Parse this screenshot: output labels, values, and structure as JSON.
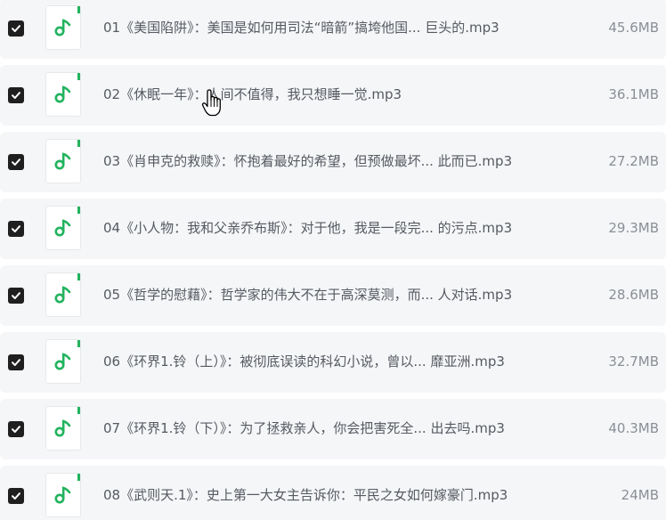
{
  "files": [
    {
      "name": "01《美国陷阱》：美国是如何用司法“暗箭”搞垮他国...  巨头的.mp3",
      "size": "45.6MB",
      "checked": true,
      "icon": "music-file-icon"
    },
    {
      "name": "02《休眠一年》：人间不值得，我只想睡一觉.mp3",
      "size": "36.1MB",
      "checked": true,
      "icon": "music-file-icon"
    },
    {
      "name": "03《肖申克的救赎》：怀抱着最好的希望，但预做最坏...  此而已.mp3",
      "size": "27.2MB",
      "checked": true,
      "icon": "music-file-icon"
    },
    {
      "name": "04《小人物：我和父亲乔布斯》：对于他，我是一段完...  的污点.mp3",
      "size": "29.3MB",
      "checked": true,
      "icon": "music-file-icon"
    },
    {
      "name": "05《哲学的慰藉》：哲学家的伟大不在于高深莫测，而...  人对话.mp3",
      "size": "28.6MB",
      "checked": true,
      "icon": "music-file-icon"
    },
    {
      "name": "06《环界1.铃（上）》：被彻底误读的科幻小说，曾以...  靡亚洲.mp3",
      "size": "32.7MB",
      "checked": true,
      "icon": "music-file-icon"
    },
    {
      "name": "07《环界1.铃（下）》：为了拯救亲人，你会把害死全...  出去吗.mp3",
      "size": "40.3MB",
      "checked": true,
      "icon": "music-file-icon"
    },
    {
      "name": "08《武则天.1》：史上第一大女主告诉你：平民之女如何嫁豪门.mp3",
      "size": "24MB",
      "checked": true,
      "icon": "music-file-icon"
    }
  ],
  "colors": {
    "row_bg": "#f5f6f8",
    "checkbox": "#1f1f1f",
    "music_note": "#22b35e",
    "name_text": "#555a61",
    "size_text": "#8a8f96"
  },
  "cursor_icon": "hand-pointer-icon"
}
